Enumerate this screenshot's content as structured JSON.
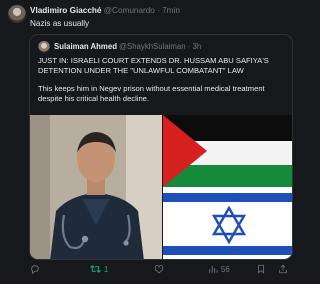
{
  "tweet": {
    "author_name": "Vladimiro Giacché",
    "author_handle": "@Comunardo",
    "dot": "·",
    "time": "7min",
    "text": "Nazis as usually"
  },
  "quoted": {
    "author_name": "Sulaiman Ahmed",
    "author_handle": "@ShaykhSulaiman",
    "dot": "·",
    "time": "3h",
    "paragraph1": "JUST IN: ISRAELI COURT EXTENDS DR. HUSSAM ABU SAFIYA'S DETENTION UNDER THE \"UNLAWFUL COMBATANT\" LAW",
    "paragraph2": "This keeps him in Negev prison without essential medical treatment despite his critical health decline."
  },
  "actions": {
    "reply_count": "",
    "retweet_count": "1",
    "like_count": "",
    "views_count": "56"
  },
  "colors": {
    "background": "#16181c",
    "text": "#e7e9ea",
    "muted": "#71767b",
    "retweet_active": "#00ba7c",
    "border": "#2f3336"
  },
  "icons": [
    "reply-icon",
    "retweet-icon",
    "like-icon",
    "views-icon",
    "bookmark-icon",
    "share-icon"
  ]
}
